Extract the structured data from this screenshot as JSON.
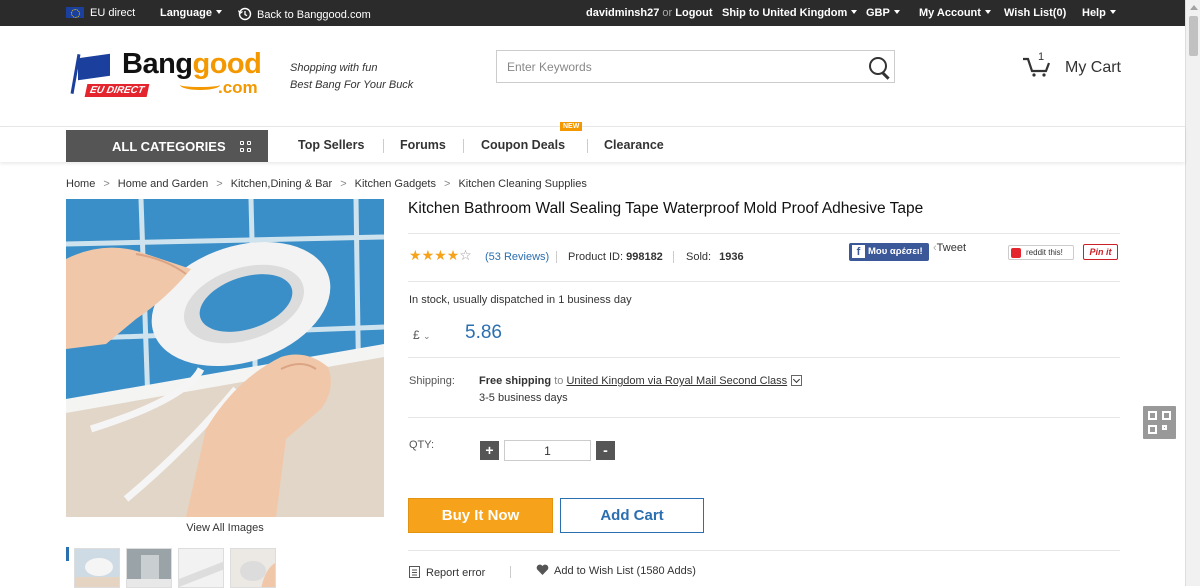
{
  "topbar": {
    "region": "EU direct",
    "language": "Language",
    "back": "Back to Banggood.com",
    "user": "davidminsh27",
    "or": "or",
    "logout": "Logout",
    "ship_to": "Ship to United Kingdom",
    "currency": "GBP",
    "account": "My Account",
    "wishlist": "Wish List(0)",
    "help": "Help"
  },
  "header": {
    "logo_bang": "Bang",
    "logo_good": "good",
    "logo_com": ".com",
    "logo_eu": "EU DIRECT",
    "slogan_1": "Shopping with fun",
    "slogan_2": "Best Bang For Your Buck",
    "search_placeholder": "Enter Keywords",
    "cart_count": "1",
    "cart_label": "My Cart"
  },
  "nav": {
    "all_categories": "ALL CATEGORIES",
    "items": [
      "Top Sellers",
      "Forums",
      "Coupon Deals",
      "Clearance"
    ],
    "new_badge": "NEW"
  },
  "breadcrumb": [
    "Home",
    "Home and Garden",
    "Kitchen,Dining & Bar",
    "Kitchen Gadgets",
    "Kitchen Cleaning Supplies"
  ],
  "gallery": {
    "view_all": "View All Images"
  },
  "product": {
    "title": "Kitchen Bathroom Wall Sealing Tape Waterproof Mold Proof Adhesive Tape",
    "rating": 4,
    "reviews": "(53 Reviews)",
    "product_id_label": "Product ID:",
    "product_id": "998182",
    "sold_label": "Sold:",
    "sold": "1936",
    "facebook_like": "Μου αρέσει!",
    "tweet": "Tweet",
    "reddit": "reddit this!",
    "pinit": "Pin it",
    "stock": "In stock, usually dispatched in 1 business day",
    "currency_symbol": "£",
    "price": "5.86",
    "shipping_label": "Shipping:",
    "free_shipping": "Free shipping",
    "to": "to",
    "ship_method": "United Kingdom via Royal Mail Second Class",
    "ship_days": "3-5 business days",
    "qty_label": "QTY:",
    "qty_value": "1",
    "qty_plus": "+",
    "qty_minus": "-",
    "buy_now": "Buy It Now",
    "add_cart": "Add Cart",
    "report_error": "Report error",
    "add_wishlist": "Add to Wish List (1580 Adds)"
  },
  "colors": {
    "topbar_bg": "#2b2b2b",
    "brand_orange": "#f39800",
    "buy_button": "#f6a21a",
    "link_blue": "#2a6fb0"
  }
}
